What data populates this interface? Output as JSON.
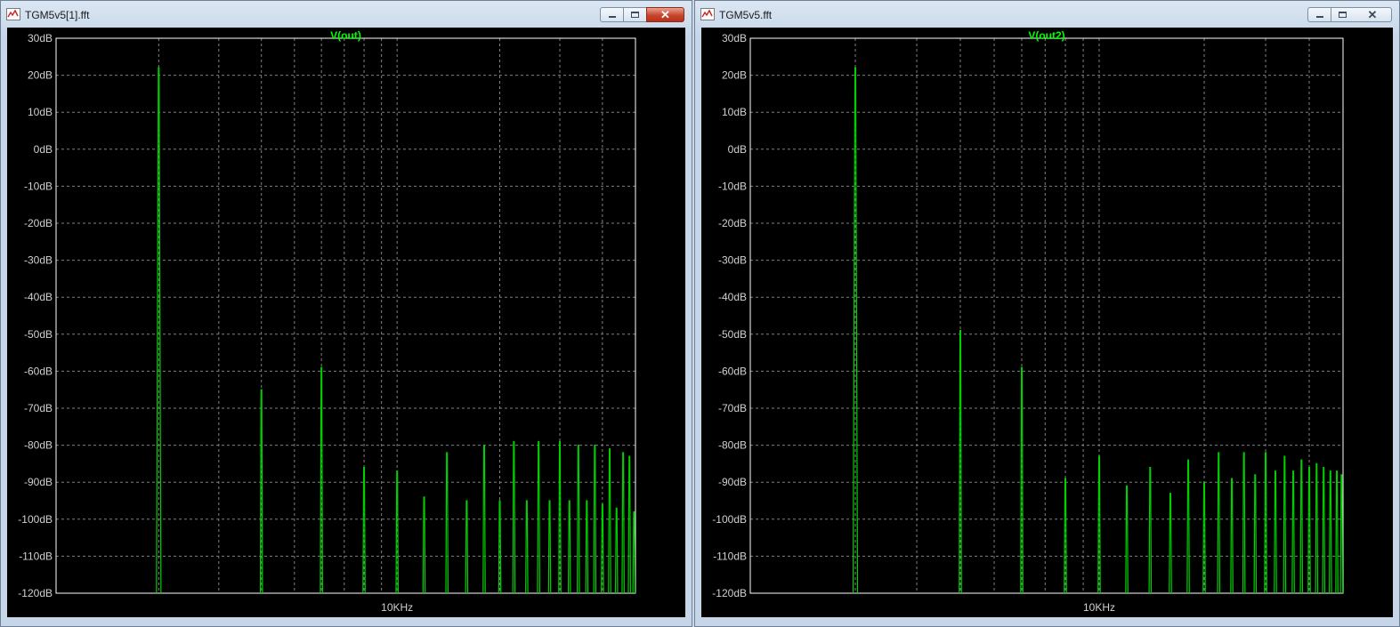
{
  "windows": [
    {
      "title": "TGM5v5[1].fft",
      "active": true,
      "minimize_glyph": "minimize-icon",
      "maximize_glyph": "maximize-icon",
      "close_glyph": "✕"
    },
    {
      "title": "TGM5v5.fft",
      "active": false,
      "minimize_glyph": "minimize-icon",
      "maximize_glyph": "maximize-icon",
      "close_glyph": "✕"
    }
  ],
  "colors": {
    "trace": "#00d000",
    "trace_title": "#00ff00",
    "axis_text": "#d0d0d0",
    "grid": "#808080",
    "frame": "#ffffff",
    "background": "#000000"
  },
  "chart_data": [
    {
      "type": "line",
      "title": "V(out)",
      "xlabel": "",
      "ylabel": "",
      "x_scale": "log",
      "xlim_hz": [
        1000,
        50000
      ],
      "ylim": [
        -120,
        30
      ],
      "yticks": [
        30,
        20,
        10,
        0,
        -10,
        -20,
        -30,
        -40,
        -50,
        -60,
        -70,
        -80,
        -90,
        -100,
        -110,
        -120
      ],
      "ytick_labels": [
        "30dB",
        "20dB",
        "10dB",
        "0dB",
        "-10dB",
        "-20dB",
        "-30dB",
        "-40dB",
        "-50dB",
        "-60dB",
        "-70dB",
        "-80dB",
        "-90dB",
        "-100dB",
        "-110dB",
        "-120dB"
      ],
      "xtick_labels": [
        {
          "x_hz": 10000,
          "label": "10KHz"
        }
      ],
      "grid": true,
      "series": [
        {
          "peaks": [
            {
              "x_hz": 2000,
              "db": 22
            },
            {
              "x_hz": 4000,
              "db": -65
            },
            {
              "x_hz": 6000,
              "db": -59
            },
            {
              "x_hz": 8000,
              "db": -86
            },
            {
              "x_hz": 10000,
              "db": -87
            },
            {
              "x_hz": 12000,
              "db": -94
            },
            {
              "x_hz": 14000,
              "db": -82
            },
            {
              "x_hz": 16000,
              "db": -95
            },
            {
              "x_hz": 18000,
              "db": -80
            },
            {
              "x_hz": 20000,
              "db": -95
            },
            {
              "x_hz": 22000,
              "db": -79
            },
            {
              "x_hz": 24000,
              "db": -95
            },
            {
              "x_hz": 26000,
              "db": -79
            },
            {
              "x_hz": 28000,
              "db": -95
            },
            {
              "x_hz": 30000,
              "db": -79
            },
            {
              "x_hz": 32000,
              "db": -95
            },
            {
              "x_hz": 34000,
              "db": -80
            },
            {
              "x_hz": 36000,
              "db": -95
            },
            {
              "x_hz": 38000,
              "db": -80
            },
            {
              "x_hz": 40000,
              "db": -96
            },
            {
              "x_hz": 42000,
              "db": -81
            },
            {
              "x_hz": 44000,
              "db": -97
            },
            {
              "x_hz": 46000,
              "db": -82
            },
            {
              "x_hz": 48000,
              "db": -83
            },
            {
              "x_hz": 49500,
              "db": -98
            }
          ]
        }
      ]
    },
    {
      "type": "line",
      "title": "V(out2)",
      "xlabel": "",
      "ylabel": "",
      "x_scale": "log",
      "xlim_hz": [
        1000,
        50000
      ],
      "ylim": [
        -120,
        30
      ],
      "yticks": [
        30,
        20,
        10,
        0,
        -10,
        -20,
        -30,
        -40,
        -50,
        -60,
        -70,
        -80,
        -90,
        -100,
        -110,
        -120
      ],
      "ytick_labels": [
        "30dB",
        "20dB",
        "10dB",
        "0dB",
        "-10dB",
        "-20dB",
        "-30dB",
        "-40dB",
        "-50dB",
        "-60dB",
        "-70dB",
        "-80dB",
        "-90dB",
        "-100dB",
        "-110dB",
        "-120dB"
      ],
      "xtick_labels": [
        {
          "x_hz": 10000,
          "label": "10KHz"
        }
      ],
      "grid": true,
      "series": [
        {
          "peaks": [
            {
              "x_hz": 2000,
              "db": 22
            },
            {
              "x_hz": 4000,
              "db": -49
            },
            {
              "x_hz": 6000,
              "db": -59
            },
            {
              "x_hz": 8000,
              "db": -89
            },
            {
              "x_hz": 10000,
              "db": -83
            },
            {
              "x_hz": 12000,
              "db": -91
            },
            {
              "x_hz": 14000,
              "db": -86
            },
            {
              "x_hz": 16000,
              "db": -93
            },
            {
              "x_hz": 18000,
              "db": -84
            },
            {
              "x_hz": 20000,
              "db": -90
            },
            {
              "x_hz": 22000,
              "db": -82
            },
            {
              "x_hz": 24000,
              "db": -89
            },
            {
              "x_hz": 26000,
              "db": -82
            },
            {
              "x_hz": 28000,
              "db": -88
            },
            {
              "x_hz": 30000,
              "db": -82
            },
            {
              "x_hz": 32000,
              "db": -87
            },
            {
              "x_hz": 34000,
              "db": -83
            },
            {
              "x_hz": 36000,
              "db": -87
            },
            {
              "x_hz": 38000,
              "db": -84
            },
            {
              "x_hz": 40000,
              "db": -86
            },
            {
              "x_hz": 42000,
              "db": -85
            },
            {
              "x_hz": 44000,
              "db": -86
            },
            {
              "x_hz": 46000,
              "db": -87
            },
            {
              "x_hz": 48000,
              "db": -87
            },
            {
              "x_hz": 49500,
              "db": -88
            }
          ]
        }
      ]
    }
  ]
}
